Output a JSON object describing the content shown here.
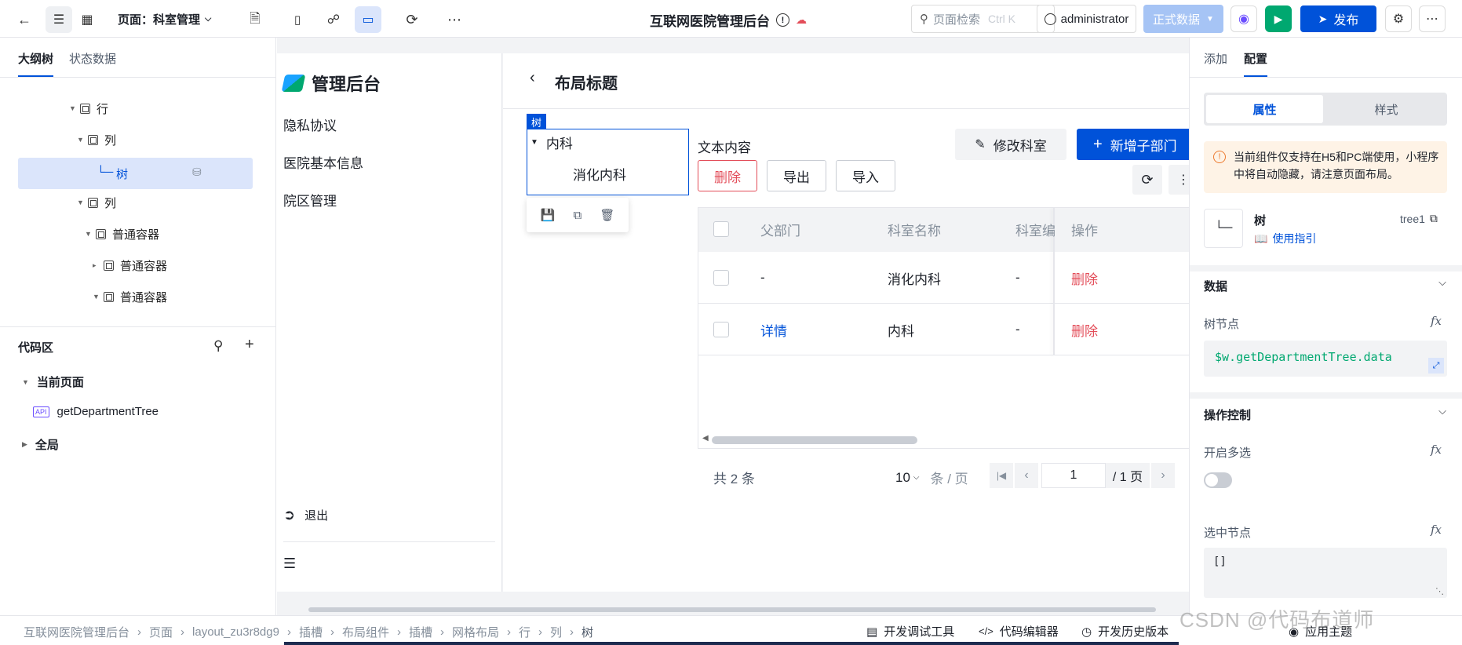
{
  "header": {
    "page_label": "页面：科室管理",
    "app_title": "互联网医院管理后台",
    "search_placeholder": "页面检索",
    "search_shortcut": "Ctrl K",
    "user": "administrator",
    "env": "正式数据",
    "publish": "发布"
  },
  "left_panel": {
    "tabs": [
      "大纲树",
      "状态数据"
    ],
    "tree": [
      {
        "label": "行",
        "level": 0
      },
      {
        "label": "列",
        "level": 1
      },
      {
        "label": "树",
        "level": 2,
        "selected": true
      },
      {
        "label": "列",
        "level": 1
      },
      {
        "label": "普通容器",
        "level": 2
      },
      {
        "label": "普通容器",
        "level": 3
      },
      {
        "label": "普通容器",
        "level": 3
      }
    ],
    "code_title": "代码区",
    "current_page": "当前页面",
    "api_badge": "API",
    "api_name": "getDepartmentTree",
    "global": "全局"
  },
  "canvas": {
    "brand": "管理后台",
    "menu": [
      "隐私协议",
      "医院基本信息",
      "院区管理"
    ],
    "logout": "退出",
    "page_title": "布局标题",
    "tree_tag": "树",
    "tree_parent": "内科",
    "tree_child": "消化内科",
    "text_content": "文本内容",
    "buttons": {
      "delete": "删除",
      "export": "导出",
      "import": "导入",
      "edit": "修改科室",
      "add": "新增子部门"
    },
    "table": {
      "headers": [
        "父部门",
        "科室名称",
        "科室编",
        "操作"
      ],
      "rows": [
        {
          "parent": "-",
          "name": "消化内科",
          "code": "-",
          "action": "删除"
        },
        {
          "parent": "详情",
          "name": "内科",
          "code": "-",
          "action": "删除"
        }
      ]
    },
    "pagination": {
      "total": "共 2 条",
      "page_size": "10",
      "per_page": "条 / 页",
      "current": "1",
      "pages": "/ 1 页"
    }
  },
  "right_panel": {
    "tabs": [
      "添加",
      "配置"
    ],
    "subtabs": [
      "属性",
      "样式"
    ],
    "notice": "当前组件仅支持在H5和PC端使用，小程序中将自动隐藏，请注意页面布局。",
    "component_name": "树",
    "component_id": "tree1",
    "guide": "使用指引",
    "data_section": "数据",
    "tree_nodes_label": "树节点",
    "tree_nodes_value": "$w.getDepartmentTree.data",
    "op_section": "操作控制",
    "multi_label": "开启多选",
    "selected_label": "选中节点",
    "selected_value": "[]",
    "fx": "fx"
  },
  "footer": {
    "breadcrumbs": [
      "互联网医院管理后台",
      "页面",
      "layout_zu3r8dg9",
      "插槽",
      "布局组件",
      "插槽",
      "网格布局",
      "行",
      "列",
      "树"
    ],
    "tools": [
      "开发调试工具",
      "代码编辑器",
      "开发历史版本",
      "应用主题"
    ],
    "watermark": "CSDN @代码布道师"
  },
  "colors": {
    "primary": "#0052d9",
    "danger": "#e34d59",
    "selected_bg": "#dbe5fb",
    "green": "#00a870"
  }
}
